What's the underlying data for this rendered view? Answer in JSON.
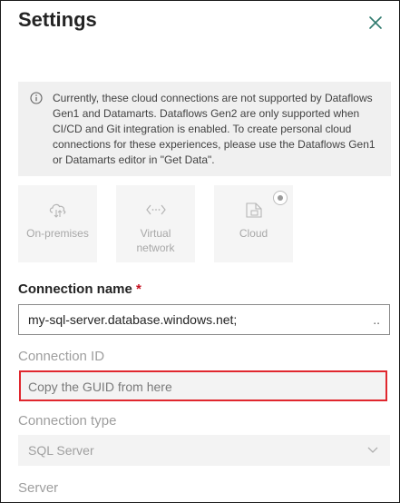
{
  "panel": {
    "title": "Settings",
    "close_icon": "close-icon"
  },
  "info": {
    "icon": "info-icon",
    "text": "Currently, these cloud connections are not supported by Dataflows Gen1 and Datamarts. Dataflows Gen2 are only supported when CI/CD and Git integration is enabled. To create personal cloud connections for these experiences, please use the Dataflows Gen1 or Datamarts editor in \"Get Data\"."
  },
  "connection_types": [
    {
      "label": "On-premises",
      "icon": "cloud-gateway-icon"
    },
    {
      "label": "Virtual network",
      "icon": "virtual-network-icon"
    },
    {
      "label": "Cloud",
      "icon": "cloud-document-icon",
      "selected": true
    }
  ],
  "fields": {
    "connection_name": {
      "label": "Connection name",
      "required_marker": "*",
      "value": "my-sql-server.database.windows.net;",
      "overflow_indicator": ".."
    },
    "connection_id": {
      "label": "Connection ID",
      "placeholder": "Copy the GUID from here"
    },
    "connection_type": {
      "label": "Connection type",
      "value": "SQL Server"
    },
    "server": {
      "label": "Server"
    }
  },
  "colors": {
    "highlight_border": "#e0272e",
    "required": "#c50f1f",
    "accent_close": "#2f7a6e"
  }
}
